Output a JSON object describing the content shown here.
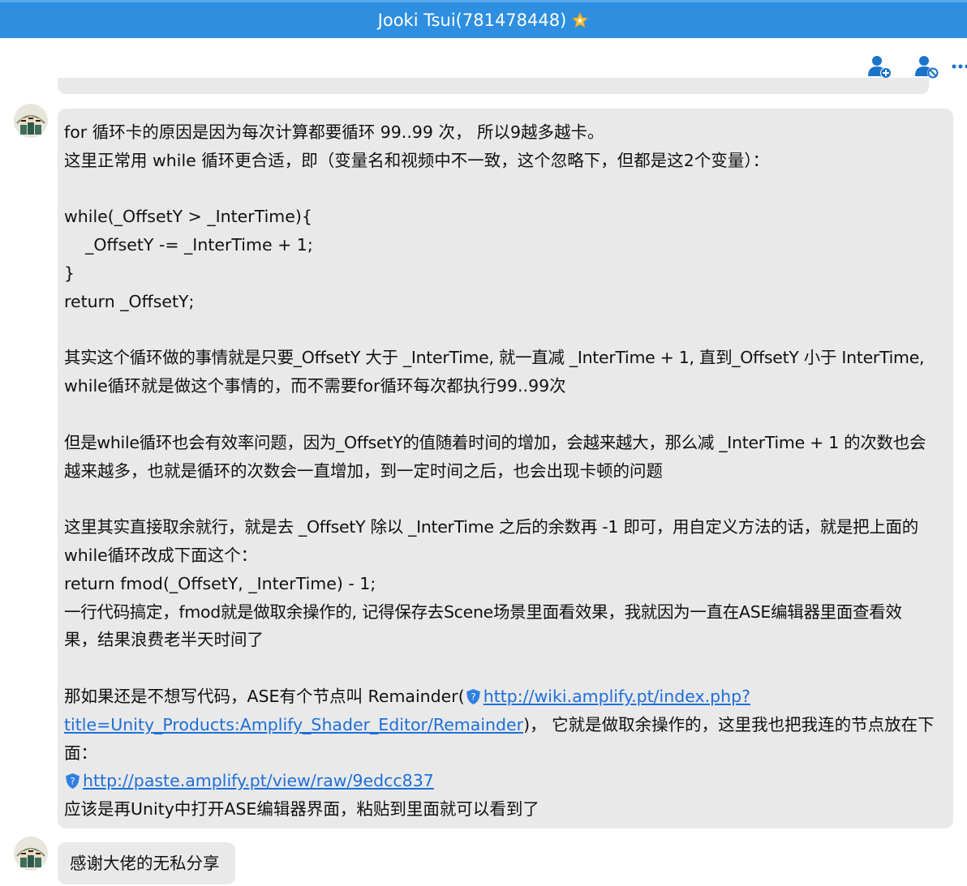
{
  "window": {
    "title": "Jooki Tsui(781478448)"
  },
  "toolbar": {
    "icons": [
      "add-friend-icon",
      "block-user-icon",
      "more-icon"
    ]
  },
  "messages": [
    {
      "lines": {
        "l1": "for 循环卡的原因是因为每次计算都要循环 99..99 次， 所以9越多越卡。",
        "l2": "这里正常用 while 循环更合适，即（变量名和视频中不一致，这个忽略下，但都是这2个变量）：",
        "l4": "while(_OffsetY > _InterTime){",
        "l5": "    _OffsetY -= _InterTime + 1;",
        "l6": "}",
        "l7": "return _OffsetY;",
        "l9": "其实这个循环做的事情就是只要_OffsetY 大于 _InterTime, 就一直减 _InterTime + 1, 直到_OffsetY 小于 InterTime,",
        "l10": "while循环就是做这个事情的，而不需要for循环每次都执行99..99次",
        "l12": "但是while循环也会有效率问题，因为_OffsetY的值随着时间的增加，会越来越大，那么减 _InterTime + 1 的次数也会",
        "l13": "越来越多，也就是循环的次数会一直增加，到一定时间之后，也会出现卡顿的问题",
        "l15": "这里其实直接取余就行，就是去 _OffsetY 除以 _InterTime 之后的余数再 -1 即可，用自定义方法的话，就是把上面的",
        "l16": "while循环改成下面这个：",
        "l17": "return fmod(_OffsetY, _InterTime) - 1;",
        "l18": "一行代码搞定，fmod就是做取余操作的, 记得保存去Scene场景里面看效果，我就因为一直在ASE编辑器里面查看效",
        "l19": "果，结果浪费老半天时间了",
        "l21_pre": "那如果还是不想写代码，ASE有个节点叫 Remainder(",
        "l21_link": "http://wiki.amplify.pt/index.php?",
        "l22_link": "title=Unity_Products:Amplify_Shader_Editor/Remainder",
        "l22_post": ")， 它就是做取余操作的，这里我也把我连的节点放在下",
        "l23": "面：",
        "l24_link": "http://paste.amplify.pt/view/raw/9edcc837",
        "l25": "应该是再Unity中打开ASE编辑器界面，粘贴到里面就可以看到了"
      }
    },
    {
      "text": "感谢大佬的无私分享"
    }
  ],
  "colors": {
    "titlebar": "#2e8fe0",
    "bubble": "#e9e9e9",
    "link": "#1e6fd9",
    "icon": "#1a73c9"
  }
}
